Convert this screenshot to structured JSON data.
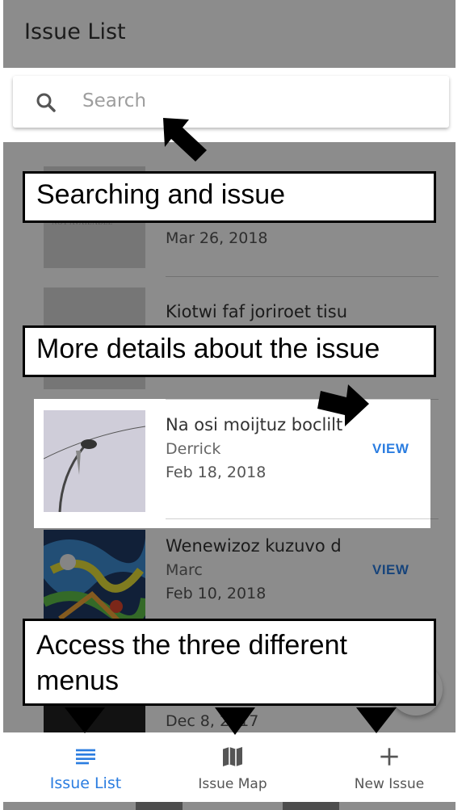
{
  "header": {
    "title": "Issue List"
  },
  "search": {
    "placeholder": "Search"
  },
  "issues": [
    {
      "title": "",
      "author": "",
      "date": "Mar 26, 2018",
      "thumb": "NOT AVAILABLE",
      "view": ""
    },
    {
      "title": "Kiotwi faf joriroet tisu",
      "author": "",
      "date": "",
      "view": ""
    },
    {
      "title": "Na osi moijtuz boclilt",
      "author": "Derrick",
      "date": "Feb 18, 2018",
      "view": "VIEW"
    },
    {
      "title": "Wenewizoz kuzuvo d",
      "author": "Marc",
      "date": "Feb 10, 2018",
      "view": "VIEW"
    },
    {
      "title": "",
      "author": "",
      "date": "Dec 8, 2017",
      "view": ""
    }
  ],
  "nav": {
    "items": [
      {
        "label": "Issue List",
        "icon": "list-icon",
        "active": true
      },
      {
        "label": "Issue Map",
        "icon": "map-icon",
        "active": false
      },
      {
        "label": "New Issue",
        "icon": "plus-icon",
        "active": false
      }
    ]
  },
  "callouts": {
    "search": "Searching and issue",
    "details": "More details about the issue",
    "menus": "Access the three different menus"
  },
  "colors": {
    "accent": "#2b7de0",
    "overlay": "rgba(0,0,0,0.45)"
  }
}
